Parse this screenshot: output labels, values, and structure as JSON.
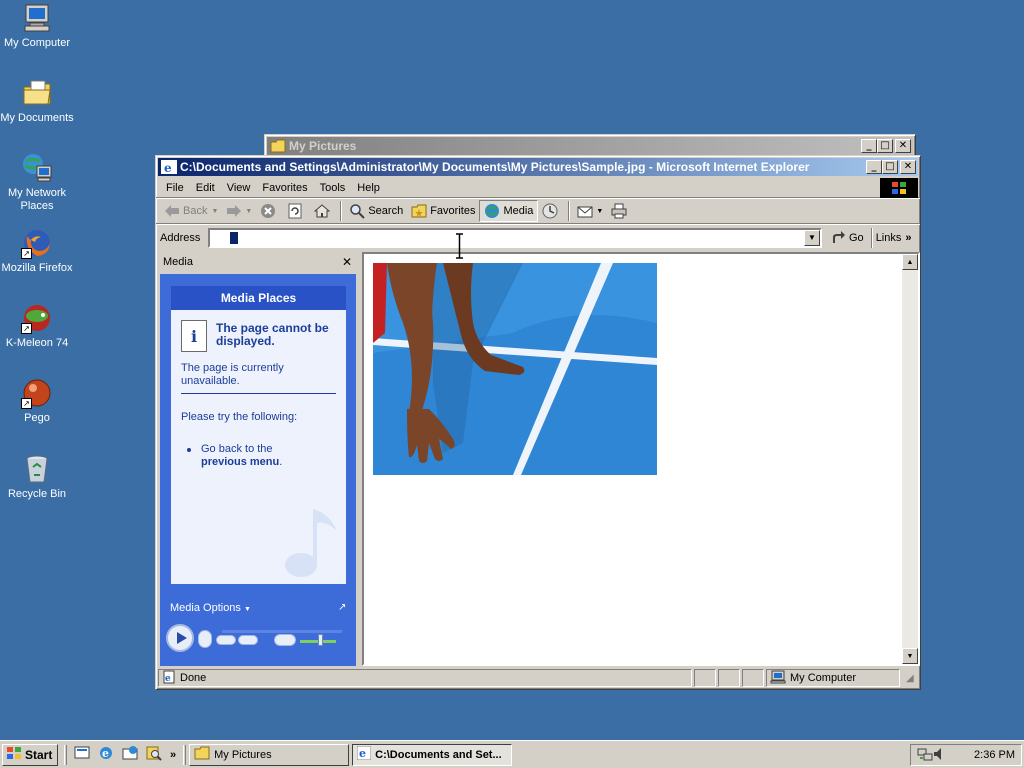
{
  "desktop": {
    "icons": [
      {
        "label": "My Computer"
      },
      {
        "label": "My Documents"
      },
      {
        "label": "My Network Places"
      },
      {
        "label": "Mozilla Firefox"
      },
      {
        "label": "K-Meleon 74"
      },
      {
        "label": "Pego"
      },
      {
        "label": "Recycle Bin"
      }
    ]
  },
  "back_window": {
    "title": "My Pictures"
  },
  "ie_window": {
    "title": "C:\\Documents and Settings\\Administrator\\My Documents\\My Pictures\\Sample.jpg - Microsoft Internet Explorer",
    "menu": [
      "File",
      "Edit",
      "View",
      "Favorites",
      "Tools",
      "Help"
    ],
    "toolbar": {
      "back": "Back",
      "search": "Search",
      "favorites": "Favorites",
      "media": "Media"
    },
    "address": {
      "label": "Address",
      "value": "",
      "go": "Go",
      "links": "Links"
    },
    "media_pane": {
      "title": "Media",
      "card_title": "Media Places",
      "error_title": "The page cannot be displayed.",
      "error_sub": "The page is currently unavailable.",
      "try_text": "Please try the following:",
      "bullet_text": "Go back to the",
      "bullet_bold": "previous menu",
      "bullet_end": ".",
      "media_options": "Media Options"
    },
    "status": {
      "text": "Done",
      "zone": "My Computer"
    }
  },
  "taskbar": {
    "start": "Start",
    "tasks": [
      {
        "label": "My Pictures"
      },
      {
        "label": "C:\\Documents and Set..."
      }
    ],
    "clock": "2:36 PM"
  },
  "colors": {
    "desktop": "#3a6ea5",
    "title_active": "#0a246a",
    "media_blue": "#3d6bd8"
  }
}
